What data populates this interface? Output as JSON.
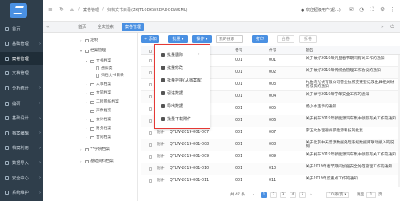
{
  "sidebar": {
    "items": [
      {
        "label": "首页",
        "active": false,
        "arrow": false
      },
      {
        "label": "基础管理",
        "active": false,
        "arrow": true
      },
      {
        "label": "案卷管理",
        "active": true,
        "arrow": false
      },
      {
        "label": "文档管理",
        "active": false,
        "arrow": false
      },
      {
        "label": "分析统计",
        "active": false,
        "arrow": true
      },
      {
        "label": "编研",
        "active": false,
        "arrow": true
      },
      {
        "label": "基础设计",
        "active": false,
        "arrow": true
      },
      {
        "label": "档案编辑",
        "active": false,
        "arrow": true
      },
      {
        "label": "档案利用",
        "active": false,
        "arrow": true
      },
      {
        "label": "数据导入",
        "active": false,
        "arrow": true
      },
      {
        "label": "安全中心",
        "active": false,
        "arrow": true
      },
      {
        "label": "系统维护",
        "active": false,
        "arrow": true
      }
    ]
  },
  "topbar": {
    "breadcrumb_1": "案卷管理",
    "breadcrumb_2": "归档文书目录(ZKJT10DKWSDADQDWSML)",
    "user_text": "● 欢迎超级用户(超…)",
    "colors": {
      "sidebar": "#2f3e4b",
      "accent": "#4a90e2",
      "highlight": "#e53935"
    }
  },
  "tabs": [
    {
      "label": "首页",
      "active": false
    },
    {
      "label": "全文检索",
      "active": false
    },
    {
      "label": "案卷管理",
      "active": true
    }
  ],
  "tree": {
    "nodes": [
      {
        "label": "定制",
        "level": 1,
        "kind": "folder"
      },
      {
        "label": "档案管理",
        "level": 1,
        "kind": "folder"
      },
      {
        "label": "文书档案",
        "level": 2,
        "kind": "folder"
      },
      {
        "label": "通知类",
        "level": 3,
        "kind": "file"
      },
      {
        "label": "归档文书目录",
        "level": 3,
        "kind": "file"
      },
      {
        "label": "人事档案",
        "level": 2,
        "kind": "folder"
      },
      {
        "label": "合同档案",
        "level": 2,
        "kind": "folder"
      },
      {
        "label": "工程图纸档案",
        "level": 2,
        "kind": "folder"
      },
      {
        "label": "声像档案",
        "level": 2,
        "kind": "folder"
      },
      {
        "label": "会计档案",
        "level": 2,
        "kind": "folder"
      },
      {
        "label": "财务档案",
        "level": 2,
        "kind": "folder"
      },
      {
        "label": "合同档案",
        "level": 2,
        "kind": "folder"
      },
      {
        "label": "**学院档案",
        "level": 1,
        "kind": "folder"
      },
      {
        "label": "基础资料档案",
        "level": 1,
        "kind": "folder"
      }
    ]
  },
  "toolbar": {
    "add_label": "+ 添加",
    "batch_label": "批量 ▾",
    "ops_label": "操作 ▾",
    "search_placeholder": "我的搜索",
    "print_label": "打印",
    "merge_label": "合卷",
    "merge2_label": "拆卷"
  },
  "dropdown": {
    "items": [
      {
        "label": "批量删除",
        "arrow": true
      },
      {
        "label": "批量修改",
        "arrow": false
      },
      {
        "label": "批量挂接(从档案库)",
        "arrow": false
      },
      {
        "label": "引进数据",
        "arrow": false
      },
      {
        "label": "导出数据",
        "arrow": false
      },
      {
        "label": "批量下载附件",
        "arrow": false
      }
    ]
  },
  "table": {
    "headers": [
      "",
      "档号",
      "卷号",
      "件号",
      "题名"
    ],
    "rows": [
      {
        "attach": "",
        "code": "QTLW-2019-001-001",
        "vol": "001",
        "piece": "001",
        "title": "关于做好2019年元旦春节期间有关工作的通知"
      },
      {
        "attach": "",
        "code": "QTLW-2019-001-002",
        "vol": "001",
        "piece": "002",
        "title": "关于做好2019年传统会管理工作会议的通知"
      },
      {
        "attach": "",
        "code": "QTLW-2019-001-003",
        "vol": "001",
        "piece": "003",
        "title": "九曲湾光伏有限公司营业执照变更登记及出具相关财务报表的通知"
      },
      {
        "attach": "",
        "code": "QTLW-2019-001-004",
        "vol": "001",
        "piece": "004",
        "title": "关于举行2019年学年安全工作的通知"
      },
      {
        "attach": "附件",
        "code": "QTLW-2019-001-005",
        "vol": "001",
        "piece": "005",
        "title": "杨小冰违章的通知"
      },
      {
        "attach": "附件",
        "code": "QTLW-2019-001-006",
        "vol": "001",
        "piece": "006",
        "title": "关于发布2019年新能源汽车集中领取有关工作的通知"
      },
      {
        "attach": "附件",
        "code": "QTLW-2019-001-007",
        "vol": "001",
        "piece": "007",
        "title": "李正文办理德州邦能源科技的批复"
      },
      {
        "attach": "附件",
        "code": "QTLW-2019-001-008",
        "vol": "001",
        "piece": "008",
        "title": "关于北京中天普源数据处理系统数据库联动接入的说明"
      },
      {
        "attach": "附件",
        "code": "QTLW-2019-001-009",
        "vol": "001",
        "piece": "009",
        "title": "关于发布2019年新能源汽车集中领取有关工作的通知"
      },
      {
        "attach": "附件",
        "code": "QTLW-2019-001-010",
        "vol": "001",
        "piece": "010",
        "title": "关于2019年春节期间加强安全防范管理工作的通知"
      },
      {
        "attach": "附件",
        "code": "QTLW-2019-001-011",
        "vol": "001",
        "piece": "011",
        "title": "关于2019年度重点工作的通知"
      }
    ]
  },
  "pager": {
    "total": "共 47 条",
    "pages": [
      "1",
      "2",
      "3",
      "4",
      "5"
    ],
    "active_page": "1",
    "per_page": "10 条/页 ▾",
    "goto_label": "跳至",
    "goto_page": "1",
    "goto_suffix": "页"
  }
}
